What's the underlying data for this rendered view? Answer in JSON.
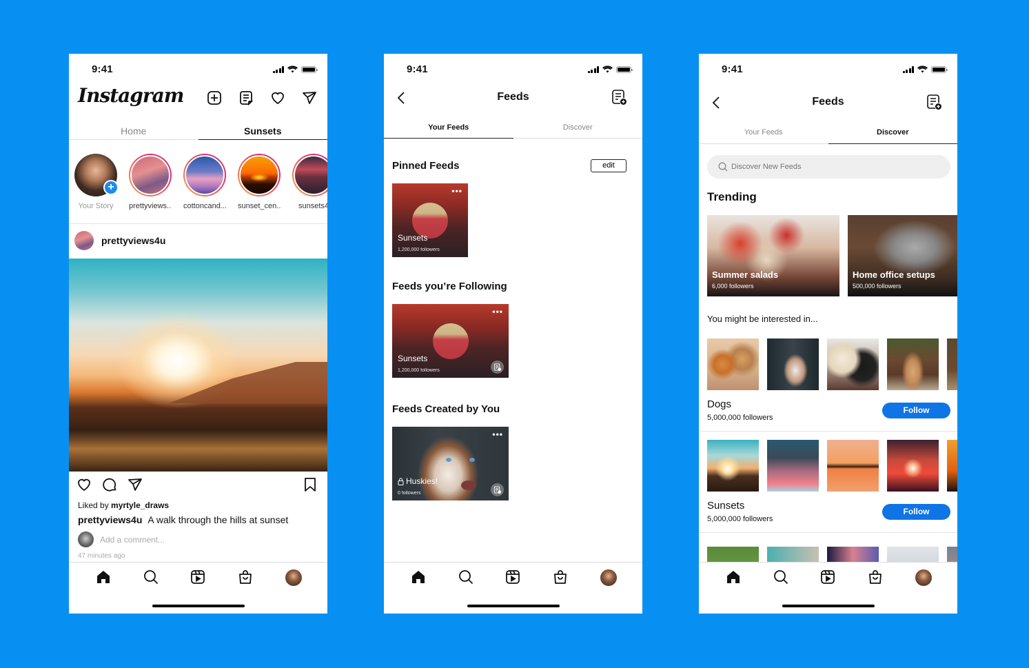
{
  "background_color": "#0790F2",
  "accent_color": "#0f74e5",
  "status_bar": {
    "time": "9:41"
  },
  "phone1": {
    "logo": "Instagram",
    "header_icons": [
      "add-post-icon",
      "feeds-icon",
      "heart-icon",
      "direct-message-icon"
    ],
    "tabs": [
      {
        "label": "Home",
        "active": false
      },
      {
        "label": "Sunsets",
        "active": true
      }
    ],
    "stories": [
      {
        "label": "Your Story",
        "own": true
      },
      {
        "label": "prettyviews..."
      },
      {
        "label": "cottoncand..."
      },
      {
        "label": "sunset_cen..."
      },
      {
        "label": "sunsets4"
      }
    ],
    "post": {
      "username": "prettyviews4u",
      "liked_prefix": "Liked by",
      "liked_by": "myrtyle_draws",
      "caption_user": "prettyviews4u",
      "caption": "A walk through the hills at sunset",
      "comment_placeholder": "Add a comment...",
      "time_ago": "47 minutes ago"
    }
  },
  "phone2": {
    "title": "Feeds",
    "tabs": [
      {
        "label": "Your Feeds",
        "active": true
      },
      {
        "label": "Discover",
        "active": false
      }
    ],
    "pinned": {
      "title": "Pinned Feeds",
      "edit_label": "edit",
      "card": {
        "name": "Sunsets",
        "followers": "1,200,000 followers"
      }
    },
    "following": {
      "title": "Feeds you’re Following",
      "card": {
        "name": "Sunsets",
        "followers": "1,200,000 followers"
      }
    },
    "created": {
      "title": "Feeds Created by You",
      "card": {
        "name": "Huskies!",
        "followers": "0 followers",
        "private": true
      }
    },
    "more_label": "•••"
  },
  "phone3": {
    "title": "Feeds",
    "tabs": [
      {
        "label": "Your Feeds",
        "active": false
      },
      {
        "label": "Discover",
        "active": true
      }
    ],
    "search_placeholder": "Discover New Feeds",
    "trending_title": "Trending",
    "trending": [
      {
        "name": "Summer salads",
        "followers": "6,000 followers"
      },
      {
        "name": "Home office setups",
        "followers": "500,000 followers"
      }
    ],
    "interested_title": "You might be interested in...",
    "categories": [
      {
        "name": "Dogs",
        "followers": "5,000,000 followers",
        "button": "Follow"
      },
      {
        "name": "Sunsets",
        "followers": "5,000,000 followers",
        "button": "Follow"
      }
    ]
  }
}
